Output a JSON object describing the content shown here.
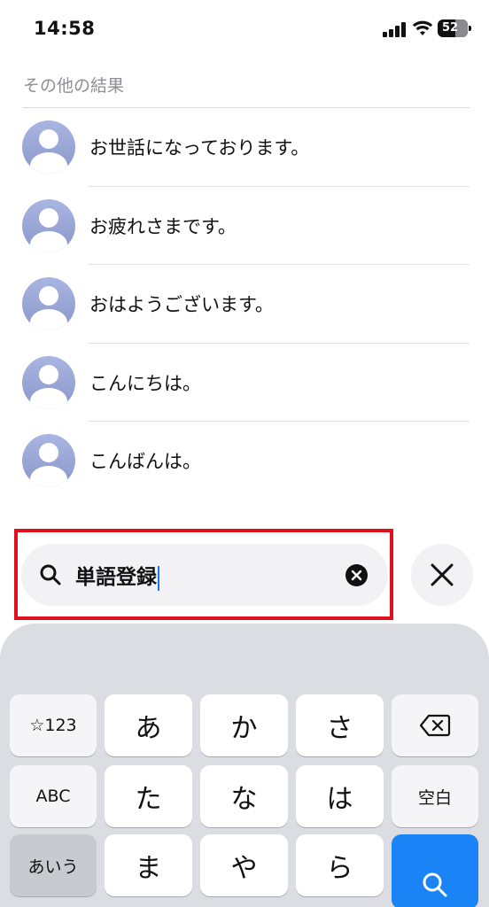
{
  "status_bar": {
    "time": "14:58",
    "battery": "52"
  },
  "results": {
    "section_title": "その他の結果",
    "items": [
      {
        "label": "お世話になっております。"
      },
      {
        "label": "お疲れさまです。"
      },
      {
        "label": "おはようございます。"
      },
      {
        "label": "こんにちは。"
      },
      {
        "label": "こんばんは。"
      }
    ]
  },
  "search": {
    "value": "単語登録"
  },
  "keyboard": {
    "row1": [
      "☆123",
      "あ",
      "か",
      "さ"
    ],
    "row2": [
      "ABC",
      "た",
      "な",
      "は",
      "空白"
    ],
    "row3": [
      "あいう",
      "ま",
      "や",
      "ら"
    ]
  },
  "colors": {
    "highlight": "#e0101e",
    "accent": "#1877f2",
    "enter_key": "#1a84f7"
  }
}
